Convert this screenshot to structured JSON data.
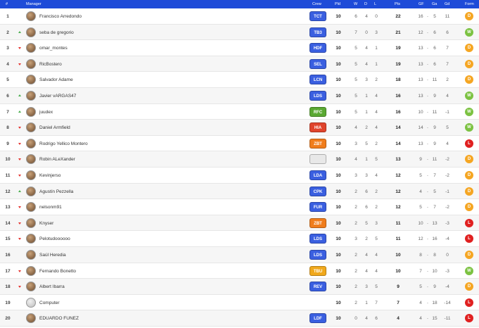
{
  "columns": {
    "pos": "#",
    "manager": "Manager",
    "crew": "Crew",
    "pld": "Pld",
    "w": "W",
    "d": "D",
    "l": "L",
    "pts": "Pts",
    "gf": "GF",
    "ga": "Ga",
    "gd": "Gd",
    "form": "Form"
  },
  "colors": {
    "header": "#1e4bd8",
    "up": "#4caf50",
    "down": "#e53935",
    "form_W": "#7cc242",
    "form_D": "#f5a623",
    "form_L": "#e02020"
  },
  "rows": [
    {
      "pos": "1",
      "trend": "none",
      "manager": "Francisco Arredondo",
      "crew": "TCT",
      "crew_color": "#3a5fe0",
      "pld": "10",
      "w": "6",
      "d": "4",
      "l": "0",
      "pts": "22",
      "gf": "16",
      "ga": "5",
      "gd": "11",
      "form": "D"
    },
    {
      "pos": "2",
      "trend": "up",
      "manager": "seba de gregorio",
      "crew": "TB3",
      "crew_color": "#3a5fe0",
      "pld": "10",
      "w": "7",
      "d": "0",
      "l": "3",
      "pts": "21",
      "gf": "12",
      "ga": "6",
      "gd": "6",
      "form": "W"
    },
    {
      "pos": "3",
      "trend": "down",
      "manager": "omar_montes",
      "crew": "HDF",
      "crew_color": "#3a5fe0",
      "pld": "10",
      "w": "5",
      "d": "4",
      "l": "1",
      "pts": "19",
      "gf": "13",
      "ga": "6",
      "gd": "7",
      "form": "D"
    },
    {
      "pos": "4",
      "trend": "down",
      "manager": "RicBostero",
      "crew": "SEL",
      "crew_color": "#3a5fe0",
      "pld": "10",
      "w": "5",
      "d": "4",
      "l": "1",
      "pts": "19",
      "gf": "13",
      "ga": "6",
      "gd": "7",
      "form": "D"
    },
    {
      "pos": "5",
      "trend": "none",
      "manager": "Salvador Adame",
      "crew": "LCN",
      "crew_color": "#3a5fe0",
      "pld": "10",
      "w": "5",
      "d": "3",
      "l": "2",
      "pts": "18",
      "gf": "13",
      "ga": "11",
      "gd": "2",
      "form": "D"
    },
    {
      "pos": "6",
      "trend": "up",
      "manager": "Javier vARGAS47",
      "crew": "LDS",
      "crew_color": "#3a5fe0",
      "pld": "10",
      "w": "5",
      "d": "1",
      "l": "4",
      "pts": "16",
      "gf": "13",
      "ga": "9",
      "gd": "4",
      "form": "W"
    },
    {
      "pos": "7",
      "trend": "up",
      "manager": "juudex",
      "crew": "RFC",
      "crew_color": "#5aa832",
      "pld": "10",
      "w": "5",
      "d": "1",
      "l": "4",
      "pts": "16",
      "gf": "10",
      "ga": "11",
      "gd": "-1",
      "form": "W"
    },
    {
      "pos": "8",
      "trend": "down",
      "manager": "Daniel Armfield",
      "crew": "HIA",
      "crew_color": "#e0442c",
      "pld": "10",
      "w": "4",
      "d": "2",
      "l": "4",
      "pts": "14",
      "gf": "14",
      "ga": "9",
      "gd": "5",
      "form": "W"
    },
    {
      "pos": "9",
      "trend": "down",
      "manager": "Rodrigo Yellico Montero",
      "crew": "ZBT",
      "crew_color": "#f07d1c",
      "pld": "10",
      "w": "3",
      "d": "5",
      "l": "2",
      "pts": "14",
      "gf": "13",
      "ga": "9",
      "gd": "4",
      "form": "L"
    },
    {
      "pos": "10",
      "trend": "down",
      "manager": "Robin ALeXander",
      "crew": "",
      "crew_color": "#e8e8e8",
      "pld": "10",
      "w": "4",
      "d": "1",
      "l": "5",
      "pts": "13",
      "gf": "9",
      "ga": "11",
      "gd": "-2",
      "form": "D"
    },
    {
      "pos": "11",
      "trend": "down",
      "manager": "Kevinjerso",
      "crew": "LDA",
      "crew_color": "#3a5fe0",
      "pld": "10",
      "w": "3",
      "d": "3",
      "l": "4",
      "pts": "12",
      "gf": "5",
      "ga": "7",
      "gd": "-2",
      "form": "D"
    },
    {
      "pos": "12",
      "trend": "up",
      "manager": "Agustín Pezzella",
      "crew": "CPK",
      "crew_color": "#3a5fe0",
      "pld": "10",
      "w": "2",
      "d": "6",
      "l": "2",
      "pts": "12",
      "gf": "4",
      "ga": "5",
      "gd": "-1",
      "form": "D"
    },
    {
      "pos": "13",
      "trend": "down",
      "manager": "nelsonm91",
      "crew": "FUR",
      "crew_color": "#3a5fe0",
      "pld": "10",
      "w": "2",
      "d": "6",
      "l": "2",
      "pts": "12",
      "gf": "5",
      "ga": "7",
      "gd": "-2",
      "form": "D"
    },
    {
      "pos": "14",
      "trend": "down",
      "manager": "Knyser",
      "crew": "ZBT",
      "crew_color": "#f07d1c",
      "pld": "10",
      "w": "2",
      "d": "5",
      "l": "3",
      "pts": "11",
      "gf": "10",
      "ga": "13",
      "gd": "-3",
      "form": "L"
    },
    {
      "pos": "15",
      "trend": "down",
      "manager": "Pelotudoooooo",
      "crew": "LDS",
      "crew_color": "#3a5fe0",
      "pld": "10",
      "w": "3",
      "d": "2",
      "l": "5",
      "pts": "11",
      "gf": "12",
      "ga": "16",
      "gd": "-4",
      "form": "L"
    },
    {
      "pos": "16",
      "trend": "none",
      "manager": "Saúl Heredia",
      "crew": "LDS",
      "crew_color": "#3a5fe0",
      "pld": "10",
      "w": "2",
      "d": "4",
      "l": "4",
      "pts": "10",
      "gf": "8",
      "ga": "8",
      "gd": "0",
      "form": "D"
    },
    {
      "pos": "17",
      "trend": "down",
      "manager": "Fernando Bonetto",
      "crew": "TBU",
      "crew_color": "#f0a81c",
      "pld": "10",
      "w": "2",
      "d": "4",
      "l": "4",
      "pts": "10",
      "gf": "7",
      "ga": "10",
      "gd": "-3",
      "form": "W"
    },
    {
      "pos": "18",
      "trend": "down",
      "manager": "Albert Ibarra",
      "crew": "REV",
      "crew_color": "#3a5fe0",
      "pld": "10",
      "w": "2",
      "d": "3",
      "l": "5",
      "pts": "9",
      "gf": "5",
      "ga": "9",
      "gd": "-4",
      "form": "D"
    },
    {
      "pos": "19",
      "trend": "none",
      "manager": "Computer",
      "crew": "",
      "crew_color": "",
      "pld": "10",
      "w": "2",
      "d": "1",
      "l": "7",
      "pts": "7",
      "gf": "4",
      "ga": "18",
      "gd": "-14",
      "form": "L"
    },
    {
      "pos": "20",
      "trend": "none",
      "manager": "EDUARDO FUNEZ",
      "crew": "LDF",
      "crew_color": "#3a5fe0",
      "pld": "10",
      "w": "0",
      "d": "4",
      "l": "6",
      "pts": "4",
      "gf": "4",
      "ga": "15",
      "gd": "-11",
      "form": "L"
    }
  ]
}
